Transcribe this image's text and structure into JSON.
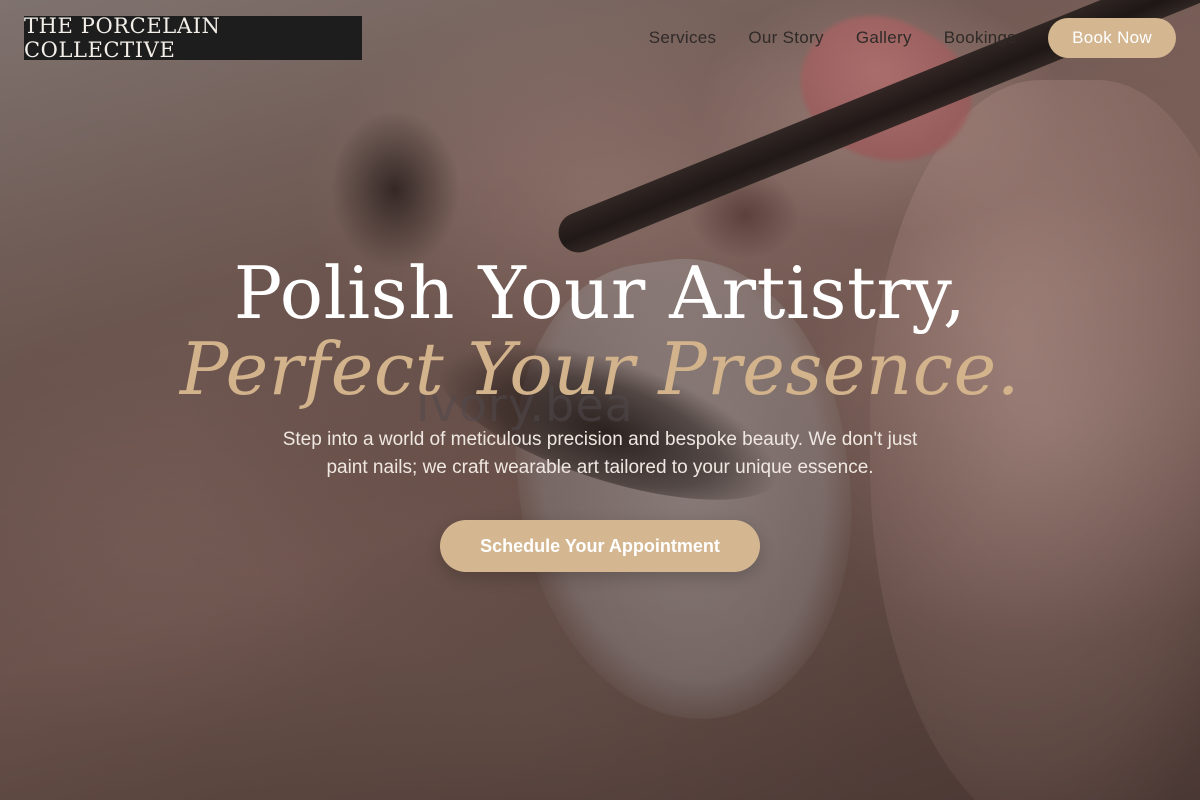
{
  "brand": {
    "name": "THE PORCELAIN COLLECTIVE"
  },
  "nav": {
    "links": [
      "Services",
      "Our Story",
      "Gallery",
      "Bookings"
    ],
    "cta_label": "Book Now"
  },
  "hero": {
    "title_line1": "Polish Your Artistry,",
    "title_line2": "Perfect Your Presence.",
    "subtitle": "Step into a world of meticulous precision and bespoke beauty. We don't just paint nails; we craft wearable art tailored to your unique essence.",
    "cta_label": "Schedule Your Appointment",
    "watermark": "Ivory.bea"
  },
  "colors": {
    "accent": "#d4b791",
    "accent_text": "#d2b38b",
    "logo_bg": "#1d1d1e"
  }
}
